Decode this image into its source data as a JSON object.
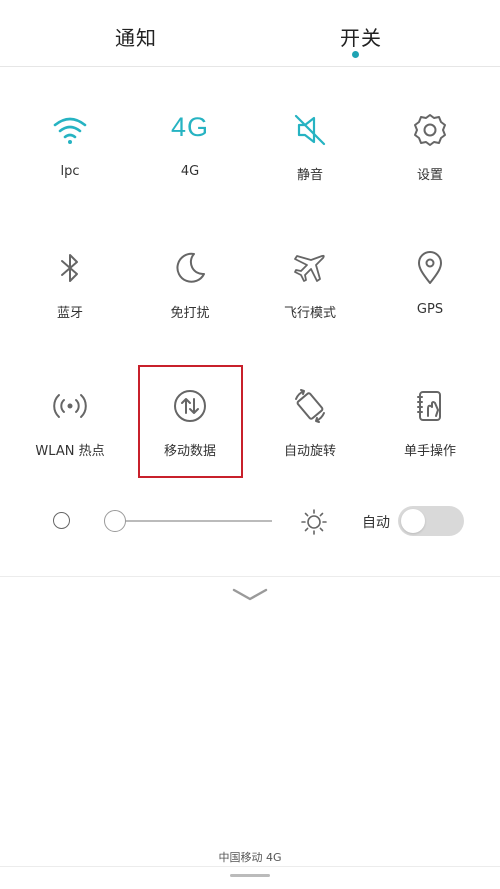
{
  "tabs": {
    "notify": "通知",
    "switch": "开关"
  },
  "toggles": [
    {
      "label": "lpc",
      "icon": "wifi-icon"
    },
    {
      "label": "4G",
      "icon": "4g-icon",
      "icon_text": "4G"
    },
    {
      "label": "静音",
      "icon": "mute-icon"
    },
    {
      "label": "设置",
      "icon": "gear-icon"
    },
    {
      "label": "蓝牙",
      "icon": "bluetooth-icon"
    },
    {
      "label": "免打扰",
      "icon": "moon-icon"
    },
    {
      "label": "飞行模式",
      "icon": "airplane-icon"
    },
    {
      "label": "GPS",
      "icon": "location-pin-icon"
    },
    {
      "label": "WLAN 热点",
      "icon": "hotspot-icon"
    },
    {
      "label": "移动数据",
      "icon": "mobile-data-icon"
    },
    {
      "label": "自动旋转",
      "icon": "rotate-icon"
    },
    {
      "label": "单手操作",
      "icon": "one-hand-icon"
    }
  ],
  "brightness": {
    "auto_label": "自动",
    "level": 0.0,
    "auto_enabled": false
  },
  "status": {
    "carrier": "中国移动 4G"
  },
  "colors": {
    "accent": "#26b3c2",
    "icon_gray": "#666666",
    "highlight_border": "#c8202b"
  }
}
